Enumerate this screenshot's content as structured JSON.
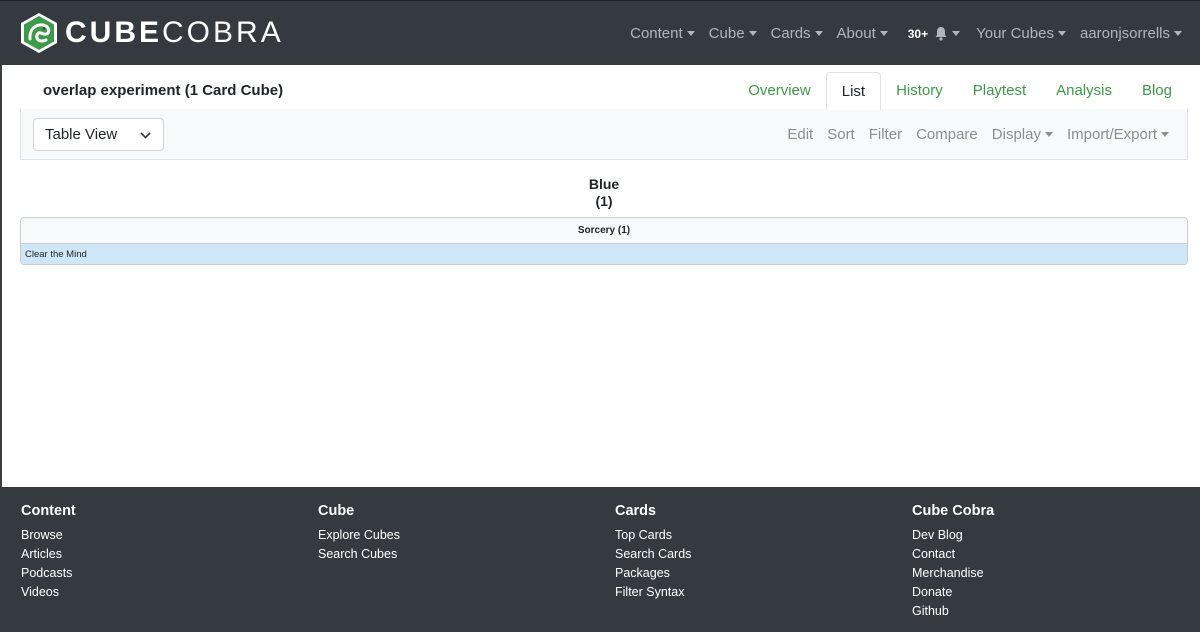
{
  "navbar": {
    "brand_bold": "CUBE",
    "brand_light": "COBRA",
    "items": [
      {
        "label": "Content"
      },
      {
        "label": "Cube"
      },
      {
        "label": "Cards"
      },
      {
        "label": "About"
      }
    ],
    "notification_count": "30+",
    "your_cubes": "Your Cubes",
    "username": "aaronjsorrells"
  },
  "cube": {
    "title": "overlap experiment (1 Card Cube)",
    "tabs": [
      {
        "label": "Overview"
      },
      {
        "label": "List"
      },
      {
        "label": "History"
      },
      {
        "label": "Playtest"
      },
      {
        "label": "Analysis"
      },
      {
        "label": "Blog"
      }
    ],
    "active_tab": "List"
  },
  "toolbar": {
    "view_select": "Table View",
    "edit": "Edit",
    "sort": "Sort",
    "filter": "Filter",
    "compare": "Compare",
    "display": "Display",
    "import_export": "Import/Export"
  },
  "list": {
    "color_name": "Blue",
    "color_count": "(1)",
    "group_header": "Sorcery (1)",
    "cards": [
      "Clear the Mind"
    ],
    "row_color": "#cfe6f7"
  },
  "footer": {
    "columns": [
      {
        "title": "Content",
        "links": [
          "Browse",
          "Articles",
          "Podcasts",
          "Videos"
        ]
      },
      {
        "title": "Cube",
        "links": [
          "Explore Cubes",
          "Search Cubes"
        ]
      },
      {
        "title": "Cards",
        "links": [
          "Top Cards",
          "Search Cards",
          "Packages",
          "Filter Syntax"
        ]
      },
      {
        "title": "Cube Cobra",
        "links": [
          "Dev Blog",
          "Contact",
          "Merchandise",
          "Donate",
          "Github"
        ]
      }
    ]
  },
  "colors": {
    "navbar_bg": "#343a40",
    "accent_green": "#3d9a49"
  }
}
